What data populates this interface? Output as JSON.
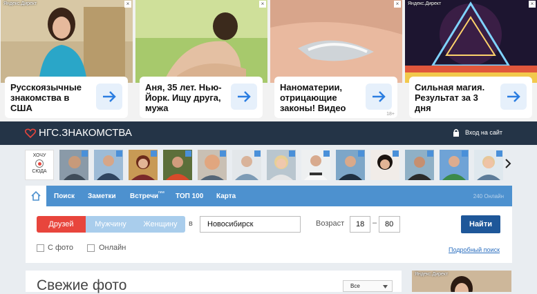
{
  "ads": [
    {
      "label": "Яндекс.Директ",
      "text": "Русскоязычные знакомства в США",
      "age": ""
    },
    {
      "label": "",
      "text": "Аня, 35 лет. Нью-Йорк. Ищу друга, мужа",
      "age": ""
    },
    {
      "label": "",
      "text": "Наноматерии, отрицающие законы! Видео",
      "age": "18+"
    },
    {
      "label": "Яндекс.Директ",
      "text": "Сильная магия. Результат за 3 дня",
      "age": ""
    }
  ],
  "header": {
    "logo": "НГС.ЗНАКОМСТВА",
    "login": "Вход на сайт"
  },
  "strip": {
    "hochu_line1": "ХОЧУ",
    "hochu_line2": "СЮДА"
  },
  "nav": {
    "items": [
      "Поиск",
      "Заметки",
      "Встречи",
      "ТОП 100",
      "Карта"
    ],
    "new_badge": "new",
    "online": "240 Онлайн"
  },
  "search": {
    "segments": [
      "Друзей",
      "Мужчину",
      "Женщину"
    ],
    "in_label": "в",
    "city": "Новосибирск",
    "age_label": "Возраст",
    "age_from": "18",
    "age_dash": "–",
    "age_to": "80",
    "submit": "Найти",
    "with_photo": "С фото",
    "online": "Онлайн",
    "advanced": "Подробный поиск"
  },
  "fresh": {
    "title": "Свежие фото",
    "filter": "Все"
  },
  "side_ad": {
    "label": "Яндекс.Директ"
  },
  "colors": {
    "header": "#243447",
    "nav": "#4d91cf",
    "active_segment": "#e8453c",
    "button": "#1e5799"
  }
}
